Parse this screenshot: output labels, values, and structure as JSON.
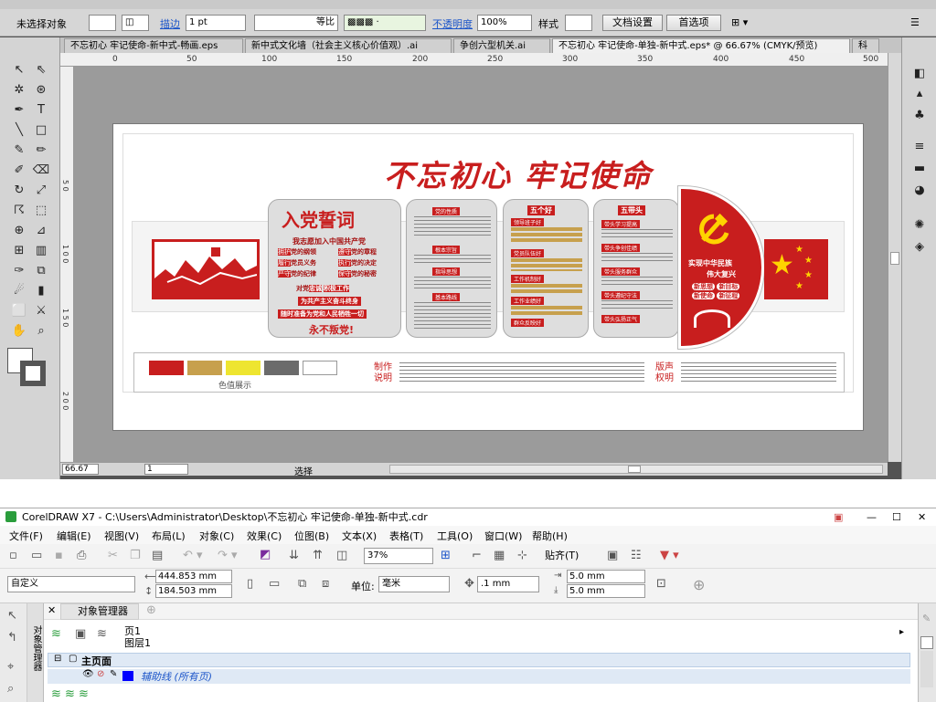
{
  "colors": {
    "red": "#c81e1e",
    "dark_red": "#a50f0f",
    "gold": "#c7a04d",
    "yellow": "#eee530",
    "gray": "#6b6b6b",
    "white": "#ffffff",
    "accent_blue": "#1c55c9",
    "flag_star": "#ffd300"
  },
  "illustrator": {
    "control": {
      "selection": "未选择对象",
      "stroke_label": "描边",
      "stroke_value": "1 pt",
      "profile": "等比",
      "opacity_label": "不透明度",
      "opacity_value": "100%",
      "style_label": "样式",
      "doc_setup": "文档设置",
      "prefs": "首选项"
    },
    "tabs": [
      "不忘初心 牢记使命-新中式-畅画.eps",
      "新中式文化墙（社会主义核心价值观）.ai",
      "争创六型机关.ai",
      "不忘初心  牢记使命-单独-新中式.eps* @ 66.67% (CMYK/预览)",
      "科"
    ],
    "ruler_ticks": [
      "0",
      "50",
      "100",
      "150",
      "200",
      "250",
      "300",
      "350",
      "400",
      "450",
      "500"
    ],
    "vruler_ticks": [
      "5 0",
      "1 0 0",
      "1 5 0",
      "2 0 0"
    ],
    "status": {
      "zoom": "66.67",
      "page": "1",
      "selection": "选择"
    },
    "tools": [
      "select-tool",
      "direct-select-tool",
      "magic-wand-tool",
      "lasso-tool",
      "pen-tool",
      "type-tool",
      "line-tool",
      "rectangle-tool",
      "paintbrush-tool",
      "pencil-tool",
      "blob-brush-tool",
      "eraser-tool",
      "rotate-tool",
      "scale-tool",
      "warp-tool",
      "free-transform-tool",
      "shape-builder-tool",
      "perspective-tool",
      "mesh-tool",
      "gradient-tool",
      "eyedropper-tool",
      "blend-tool",
      "symbol-sprayer-tool",
      "column-graph-tool",
      "artboard-tool",
      "slice-tool",
      "hand-tool",
      "zoom-tool"
    ]
  },
  "artwork": {
    "title": "不忘初心 牢记使命",
    "oath": {
      "title": "入党誓词",
      "subtitle": "我志愿加入中国共产党",
      "items": [
        [
          "拥护",
          "党的纲领"
        ],
        [
          "遵守",
          "党的章程"
        ],
        [
          "履行",
          "党员义务"
        ],
        [
          "执行",
          "党的决定"
        ],
        [
          "严守",
          "党的纪律"
        ],
        [
          "保守",
          "党的秘密"
        ]
      ],
      "line1_a": "对党",
      "line1_b": "忠诚",
      "line1_c": "积极工作",
      "line2": "为共产主义奋斗终身",
      "line3": "随时准备为党和人民牺牲一切",
      "line4": "永不叛党!"
    },
    "panel2": {
      "headers": [
        "党的性质",
        "根本宗旨",
        "指导思想",
        "基本路线"
      ]
    },
    "panel3": {
      "title": "五个好",
      "items": [
        "领导班子好",
        "党员队伍好",
        "工作机制好",
        "工作业绩好",
        "群众反映好"
      ]
    },
    "panel4": {
      "title": "五带头",
      "items": [
        "带头学习提高",
        "带头争创佳绩",
        "带头服务群众",
        "带头遵纪守法",
        "带头弘扬正气"
      ]
    },
    "emblem": {
      "line1": "实现中华民族",
      "line2": "伟大复兴",
      "tags": [
        "新思想",
        "新目标",
        "新使命",
        "新征程"
      ]
    },
    "swatch_label": "色值展示",
    "notes": {
      "make_label_1": "制作",
      "make_label_2": "说明",
      "copyright_label_1": "版声",
      "copyright_label_2": "权明"
    }
  },
  "coreldraw": {
    "title": "CorelDRAW X7 - C:\\Users\\Administrator\\Desktop\\不忘初心 牢记使命-单独-新中式.cdr",
    "menu": [
      "文件(F)",
      "编辑(E)",
      "视图(V)",
      "布局(L)",
      "对象(C)",
      "效果(C)",
      "位图(B)",
      "文本(X)",
      "表格(T)",
      "工具(O)",
      "窗口(W)",
      "帮助(H)"
    ],
    "zoom": "37%",
    "snap": "贴齐(T)",
    "page_size": "自定义",
    "width": "444.853 mm",
    "height": "184.503 mm",
    "unit_label": "单位:",
    "unit": "毫米",
    "nudge": ".1 mm",
    "dup_x": "5.0 mm",
    "dup_y": "5.0 mm",
    "object_manager": {
      "title": "对象管理器",
      "page": "页1",
      "layer": "图层1",
      "master": "主页面",
      "guides": "辅助线 (所有页)",
      "side_tab": "对象管理器"
    }
  }
}
